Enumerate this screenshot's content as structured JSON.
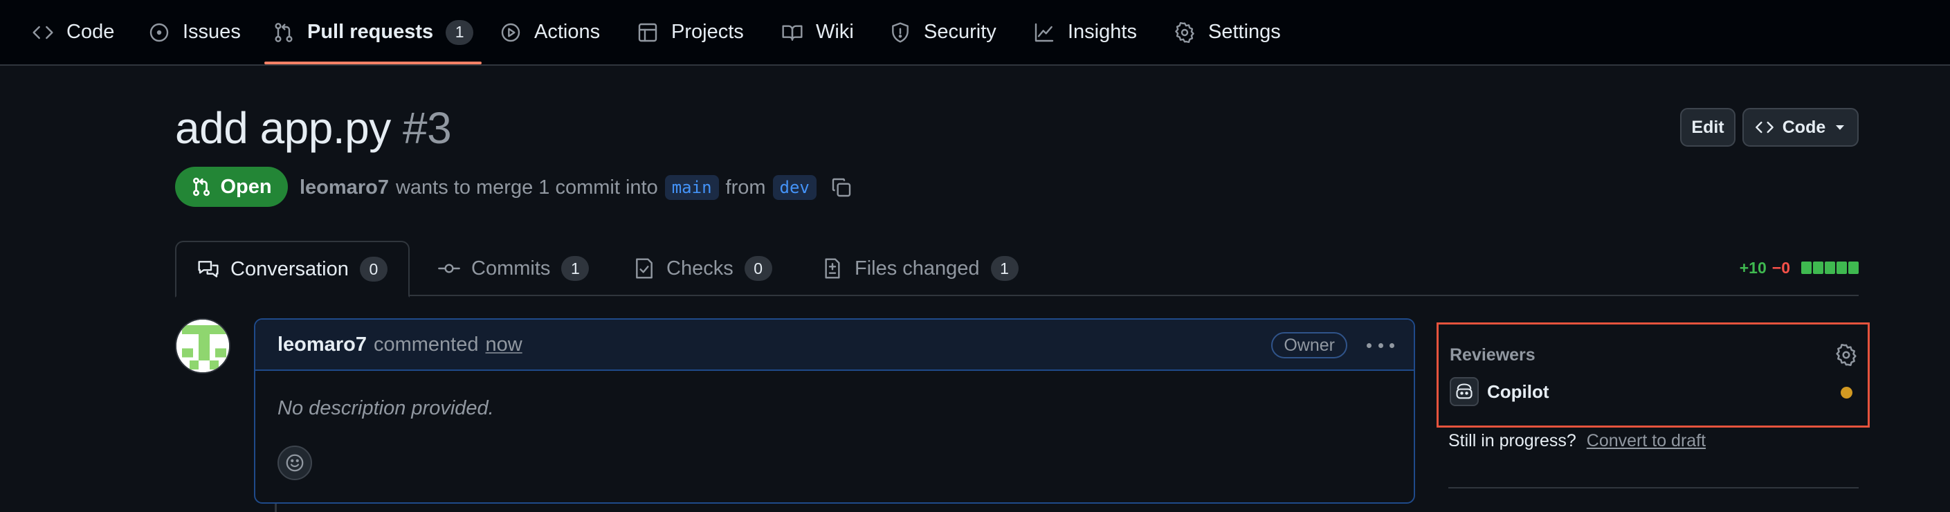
{
  "nav": {
    "items": [
      {
        "label": "Code",
        "icon": "code-icon"
      },
      {
        "label": "Issues",
        "icon": "issue-icon"
      },
      {
        "label": "Pull requests",
        "icon": "pull-request-icon",
        "count": "1",
        "active": true
      },
      {
        "label": "Actions",
        "icon": "play-icon"
      },
      {
        "label": "Projects",
        "icon": "table-icon"
      },
      {
        "label": "Wiki",
        "icon": "book-icon"
      },
      {
        "label": "Security",
        "icon": "shield-icon"
      },
      {
        "label": "Insights",
        "icon": "graph-icon"
      },
      {
        "label": "Settings",
        "icon": "gear-icon"
      }
    ]
  },
  "pr": {
    "title": "add app.py",
    "number": "#3",
    "edit_label": "Edit",
    "code_label": "Code",
    "state": "Open",
    "author": "leomaro7",
    "merge_text": "wants to merge 1 commit into",
    "base_branch": "main",
    "from_text": "from",
    "head_branch": "dev"
  },
  "tabs": [
    {
      "label": "Conversation",
      "count": "0",
      "icon": "comment-discussion-icon",
      "active": true
    },
    {
      "label": "Commits",
      "count": "1",
      "icon": "commit-icon"
    },
    {
      "label": "Checks",
      "count": "0",
      "icon": "checklist-icon"
    },
    {
      "label": "Files changed",
      "count": "1",
      "icon": "file-diff-icon"
    }
  ],
  "diffstat": {
    "additions": "+10",
    "deletions": "−0",
    "blocks": 5
  },
  "comment": {
    "author": "leomaro7",
    "action": "commented",
    "time": "now",
    "role": "Owner",
    "body": "No description provided."
  },
  "sidebar": {
    "reviewers_title": "Reviewers",
    "reviewer_name": "Copilot",
    "draft_prompt": "Still in progress?",
    "draft_link": "Convert to draft"
  },
  "colors": {
    "accent_underline": "#f78166",
    "open_green": "#238636",
    "highlight_box": "#e5533d",
    "pending_dot": "#d29922"
  }
}
